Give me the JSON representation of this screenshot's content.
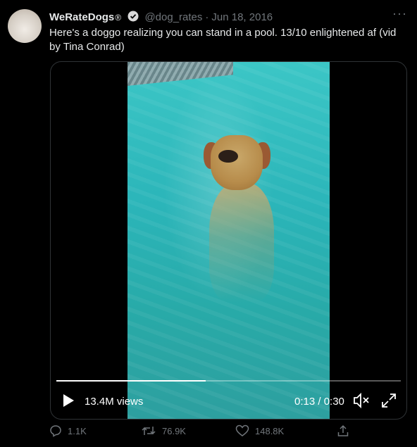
{
  "tweet": {
    "author_name": "WeRateDogs",
    "author_suffix": "®",
    "handle": "@dog_rates",
    "separator": "·",
    "date": "Jun 18, 2016",
    "text": "Here's a doggo realizing you can stand in a pool. 13/10 enlightened af (vid by Tina Conrad)",
    "more_label": "···"
  },
  "video": {
    "views": "13.4M views",
    "time": "0:13 / 0:30",
    "progress_fraction": 0.433
  },
  "actions": {
    "replies": "1.1K",
    "retweets": "76.9K",
    "likes": "148.8K"
  },
  "icons": [
    "verified-icon",
    "more-icon",
    "play-icon",
    "mute-icon",
    "fullscreen-icon",
    "reply-icon",
    "retweet-icon",
    "like-icon",
    "share-icon"
  ],
  "colors": {
    "background": "#000000",
    "muted": "#71767b",
    "text": "#e7e9ea",
    "pool": "#2bb5b9"
  }
}
